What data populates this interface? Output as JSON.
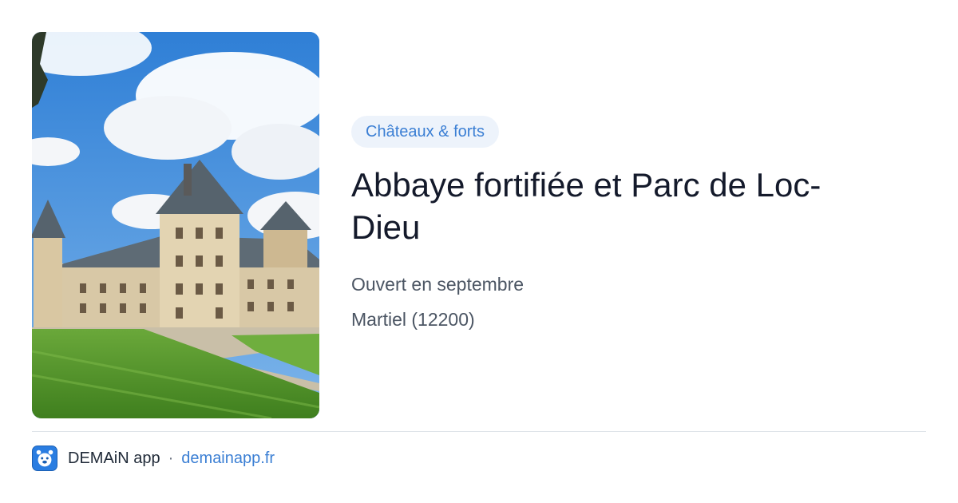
{
  "listing": {
    "category": "Châteaux & forts",
    "title": "Abbaye fortifiée et Parc de Loc-Dieu",
    "opening": "Ouvert en septembre",
    "location": "Martiel (12200)"
  },
  "footer": {
    "app_name": "DEMAiN app",
    "separator": "·",
    "site": "demainapp.fr"
  },
  "colors": {
    "accent": "#3b7fd4",
    "badge_bg": "#edf3fb",
    "title": "#141a2b",
    "meta": "#4b5563"
  }
}
